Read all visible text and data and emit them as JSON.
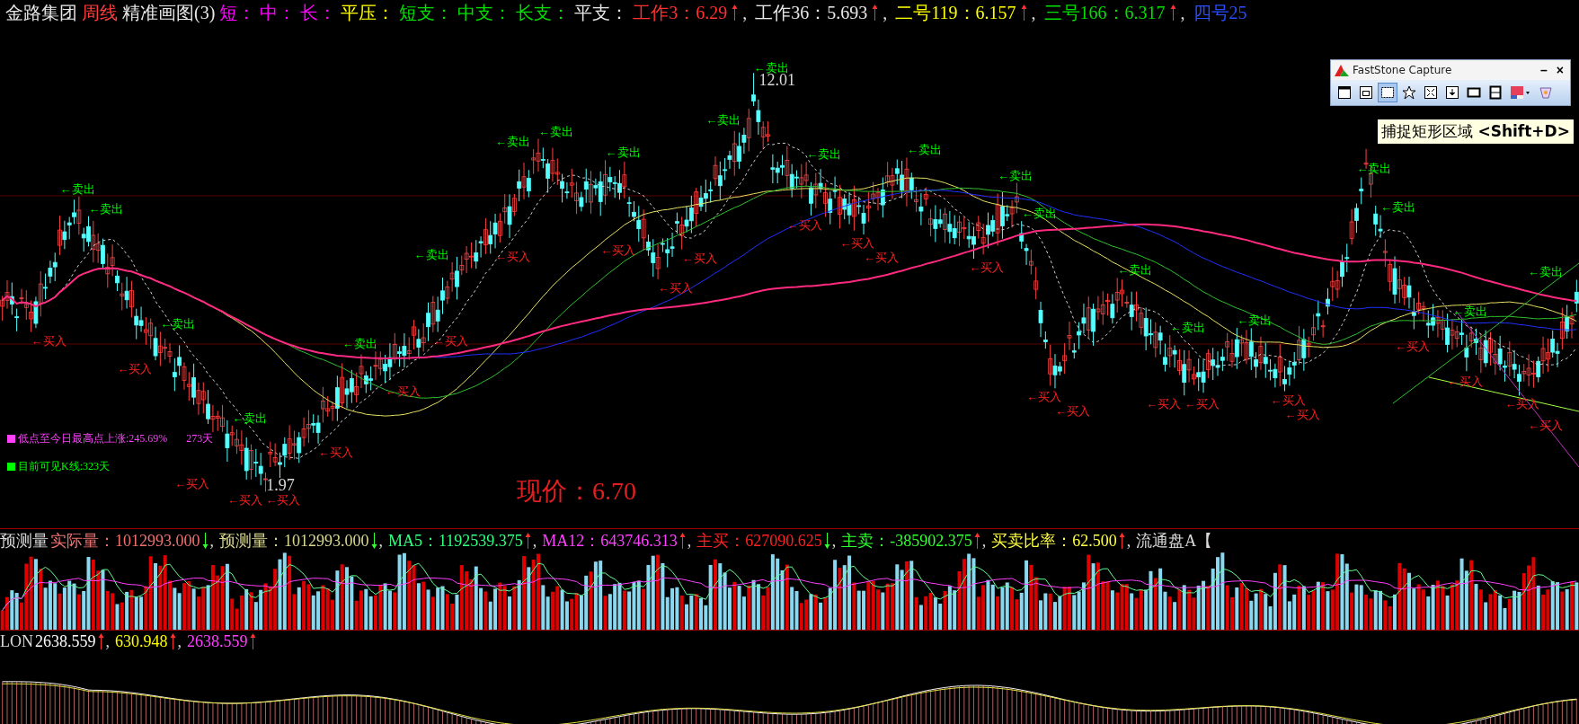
{
  "header": {
    "items": [
      {
        "text": "金路集团",
        "color": "#e8e8e8"
      },
      {
        "text": "周线",
        "color": "#ff3c3c"
      },
      {
        "text": "精准画图(3)",
        "color": "#e8e8e8"
      },
      {
        "text": "短：",
        "color": "#ff00ff"
      },
      {
        "text": "中：",
        "color": "#ff00ff"
      },
      {
        "text": "长：",
        "color": "#ff00ff"
      },
      {
        "text": "平压：",
        "color": "#ffff00"
      },
      {
        "text": "短支：",
        "color": "#00e000"
      },
      {
        "text": "中支：",
        "color": "#00e000"
      },
      {
        "text": "长支：",
        "color": "#00e000"
      },
      {
        "text": "平支：",
        "color": "#e8e8e8"
      },
      {
        "text": "工作3：6.29",
        "color": "#ff3030",
        "rising": true,
        "sep": ","
      },
      {
        "text": "工作36：5.693",
        "color": "#e8e8e8",
        "rising": true,
        "sep": ","
      },
      {
        "text": "二号119：6.157",
        "color": "#ffff00",
        "rising": true,
        "sep": ","
      },
      {
        "text": "三号166：6.317",
        "color": "#00e000",
        "rising": true,
        "sep": ","
      },
      {
        "text": "四号25",
        "color": "#2a4dff"
      }
    ]
  },
  "price_chart": {
    "high_label": "12.01",
    "low_label": "1.97",
    "current_price": "现价：6.70",
    "notes": [
      {
        "text": "低点至今日最高点上涨:245.69%",
        "extra": "273天",
        "color": "#ff40ff"
      },
      {
        "text": "目前可见K线:323天",
        "color": "#00ff00"
      }
    ],
    "signals": [
      {
        "kind": "sell",
        "label": "←卖出"
      },
      {
        "kind": "sell",
        "label": "←卖出"
      },
      {
        "kind": "sell",
        "label": "←卖出"
      },
      {
        "kind": "sell",
        "label": "←卖出"
      },
      {
        "kind": "sell",
        "label": "←卖出"
      },
      {
        "kind": "sell",
        "label": "←卖出"
      },
      {
        "kind": "sell",
        "label": "←卖出"
      },
      {
        "kind": "sell",
        "label": "←卖出"
      },
      {
        "kind": "sell",
        "label": "←卖出"
      },
      {
        "kind": "sell",
        "label": "←卖出"
      },
      {
        "kind": "sell",
        "label": "←卖出"
      },
      {
        "kind": "sell",
        "label": "←卖出"
      },
      {
        "kind": "sell",
        "label": "←卖出"
      },
      {
        "kind": "sell",
        "label": "←卖出"
      },
      {
        "kind": "sell",
        "label": "←卖出"
      },
      {
        "kind": "sell",
        "label": "←卖出"
      },
      {
        "kind": "sell",
        "label": "←卖出"
      },
      {
        "kind": "sell",
        "label": "←卖出"
      },
      {
        "kind": "sell",
        "label": "←卖出"
      },
      {
        "kind": "sell",
        "label": "←卖出"
      },
      {
        "kind": "sell",
        "label": "←卖出"
      },
      {
        "kind": "sell",
        "label": "←卖出"
      },
      {
        "kind": "buy",
        "label": "←买入"
      },
      {
        "kind": "buy",
        "label": "←买入"
      },
      {
        "kind": "buy",
        "label": "←买入"
      },
      {
        "kind": "buy",
        "label": "←买入"
      },
      {
        "kind": "buy",
        "label": "←买入"
      },
      {
        "kind": "buy",
        "label": "←买入"
      },
      {
        "kind": "buy",
        "label": "←买入"
      },
      {
        "kind": "buy",
        "label": "←买入"
      },
      {
        "kind": "buy",
        "label": "←买入"
      },
      {
        "kind": "buy",
        "label": "←买入"
      },
      {
        "kind": "buy",
        "label": "←买入"
      },
      {
        "kind": "buy",
        "label": "←买入"
      },
      {
        "kind": "buy",
        "label": "←买入"
      },
      {
        "kind": "buy",
        "label": "←买入"
      },
      {
        "kind": "buy",
        "label": "←买入"
      },
      {
        "kind": "buy",
        "label": "←买入"
      },
      {
        "kind": "buy",
        "label": "←买入"
      },
      {
        "kind": "buy",
        "label": "←买入"
      },
      {
        "kind": "buy",
        "label": "←买入"
      },
      {
        "kind": "buy",
        "label": "←买入"
      },
      {
        "kind": "buy",
        "label": "←买入"
      },
      {
        "kind": "buy",
        "label": "←买入"
      },
      {
        "kind": "buy",
        "label": "←买入"
      },
      {
        "kind": "buy",
        "label": "←买入"
      },
      {
        "kind": "buy",
        "label": "←买入"
      },
      {
        "kind": "buy",
        "label": "←买入"
      }
    ]
  },
  "capture_window": {
    "title": "FastStone Capture",
    "buttons": [
      "–",
      "×"
    ],
    "tools": [
      {
        "kind": "window",
        "selected": false
      },
      {
        "kind": "framed",
        "selected": false
      },
      {
        "kind": "rectangle",
        "selected": true
      },
      {
        "kind": "freehand",
        "selected": false
      },
      {
        "kind": "fullscreen",
        "selected": false
      },
      {
        "kind": "scroll",
        "selected": false
      },
      {
        "kind": "fixed",
        "selected": false
      },
      {
        "kind": "video",
        "selected": false
      },
      {
        "kind": "color",
        "selected": false
      },
      {
        "kind": "editor",
        "selected": false
      }
    ],
    "tooltip": "捕捉矩形区域 **<Shift+D>**"
  },
  "volume": {
    "items": [
      {
        "text": "预测量",
        "color": "#d8d8d8"
      },
      {
        "text": "实际量：1012993.000",
        "color": "#f07070",
        "rising": false,
        "sep": ","
      },
      {
        "text": "预测量：1012993.000",
        "color": "#d8d890",
        "rising": false,
        "sep": ","
      },
      {
        "text": "MA5：1192539.375",
        "color": "#30ff80",
        "rising": true,
        "sep": ","
      },
      {
        "text": "MA12：643746.313",
        "color": "#ff40ff",
        "rising": true,
        "sep": ","
      },
      {
        "text": "主买：627090.625",
        "color": "#ff2020",
        "rising": false,
        "sep": ","
      },
      {
        "text": "主卖：-385902.375",
        "color": "#30ff30",
        "rising": true,
        "sep": ","
      },
      {
        "text": "买卖比率：62.500",
        "color": "#ffff40",
        "rising": true,
        "sep": ","
      },
      {
        "text": "流通盘A【",
        "color": "#d8d8d8"
      }
    ]
  },
  "lon": {
    "items": [
      {
        "text": "LON",
        "color": "#d8d8d8"
      },
      {
        "text": "2638.559",
        "color": "#ffffff",
        "rising": true,
        "sep": ","
      },
      {
        "text": "630.948",
        "color": "#ffff00",
        "rising": true,
        "sep": ","
      },
      {
        "text": "2638.559",
        "color": "#ff40ff",
        "rising": true
      }
    ]
  }
}
